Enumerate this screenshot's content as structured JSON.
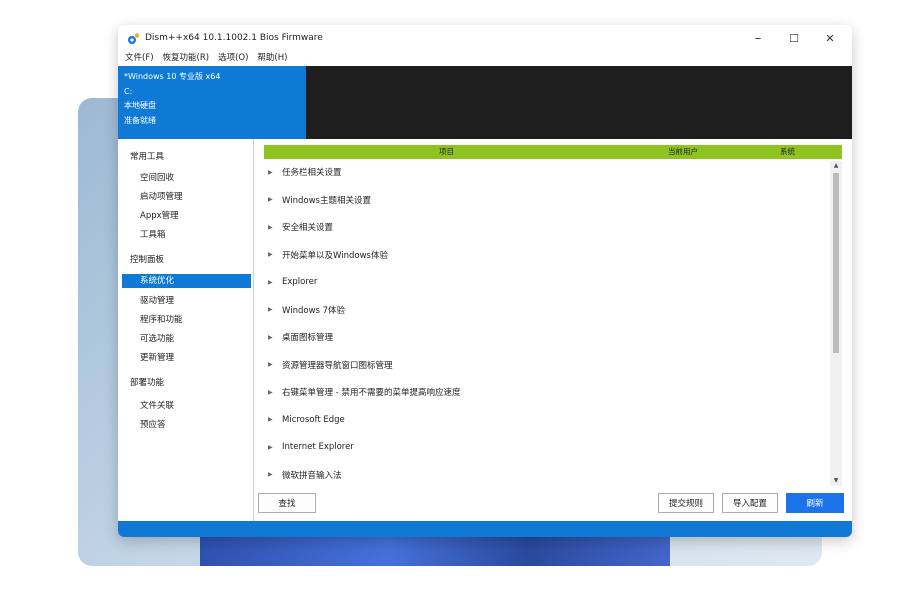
{
  "window": {
    "title": "Dism++x64 10.1.1002.1 Bios Firmware",
    "controls": {
      "minimize": "–",
      "maximize": "☐",
      "close": "✕"
    }
  },
  "menu": [
    "文件(F)",
    "恢复功能(R)",
    "选项(O)",
    "帮助(H)"
  ],
  "info": {
    "os": "*Windows 10 专业版 x64",
    "drive": "C:",
    "disk": "本地硬盘",
    "status": "准备就绪"
  },
  "sidebar": {
    "groups": [
      {
        "title": "常用工具",
        "items": [
          "空间回收",
          "启动项管理",
          "Appx管理",
          "工具箱"
        ]
      },
      {
        "title": "控制面板",
        "items": [
          "系统优化",
          "驱动管理",
          "程序和功能",
          "可选功能",
          "更新管理"
        ]
      },
      {
        "title": "部署功能",
        "items": [
          "文件关联",
          "预应答"
        ]
      }
    ],
    "selected": "系统优化"
  },
  "table": {
    "columns": [
      "项目",
      "当前用户",
      "系统"
    ],
    "rows": [
      "任务栏相关设置",
      "Windows主题相关设置",
      "安全相关设置",
      "开始菜单以及Windows体验",
      "Explorer",
      "Windows 7体验",
      "桌面图标管理",
      "资源管理器导航窗口图标管理",
      "右键菜单管理 - 禁用不需要的菜单提高响应速度",
      "Microsoft Edge",
      "Internet Explorer",
      "微软拼音输入法"
    ]
  },
  "buttons": {
    "search": "查找",
    "submit_rules": "提交规则",
    "import_config": "导入配置",
    "refresh": "刷新"
  },
  "colors": {
    "accent_blue": "#0e7ad6",
    "header_green": "#8fc31f",
    "info_dark": "#1e1e1e"
  }
}
